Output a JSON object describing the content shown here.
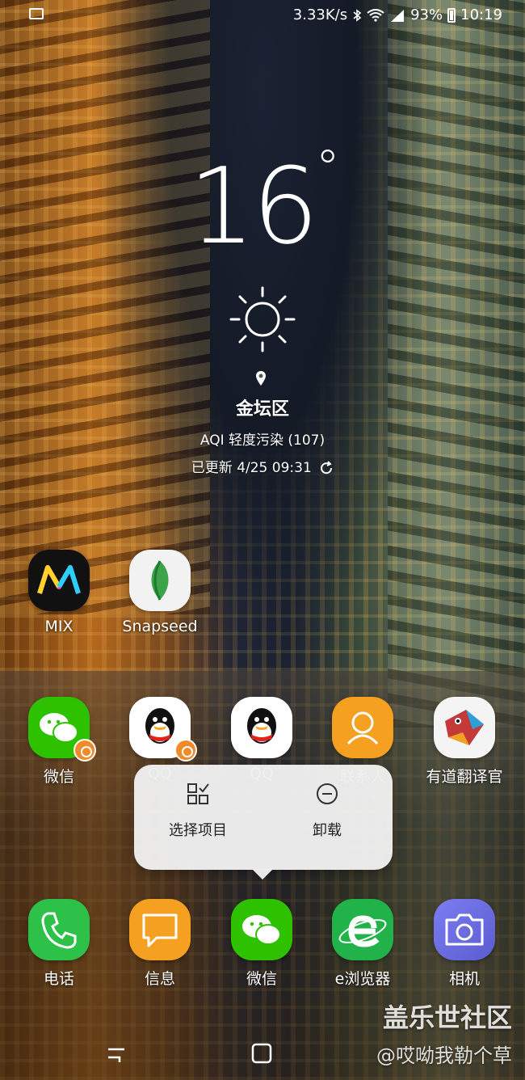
{
  "status_bar": {
    "net_speed": "3.33K/s",
    "battery": "93%",
    "time": "10:19",
    "icons": [
      "gallery-icon",
      "bluetooth-icon",
      "wifi-icon",
      "signal-icon",
      "battery-icon"
    ]
  },
  "weather": {
    "temperature": "16",
    "degree": "°",
    "icon": "sun-icon",
    "location": "金坛区",
    "aqi": "AQI 轻度污染 (107)",
    "updated": "已更新 4/25 09:31"
  },
  "apps_row1": [
    {
      "label": "MIX",
      "icon": "mix-app-icon"
    },
    {
      "label": "Snapseed",
      "icon": "snapseed-app-icon"
    }
  ],
  "apps_row2": [
    {
      "label": "微信",
      "icon": "wechat-app-icon",
      "clone": true
    },
    {
      "label": "QQ",
      "icon": "qq-app-icon",
      "clone": true
    },
    {
      "label": "QQ",
      "icon": "qq-app-icon",
      "clone": false
    },
    {
      "label": "联系人",
      "icon": "contacts-app-icon",
      "clone": false
    },
    {
      "label": "有道翻译官",
      "icon": "youdao-app-icon",
      "clone": false
    }
  ],
  "popup": {
    "select_label": "选择项目",
    "uninstall_label": "卸载"
  },
  "dock": [
    {
      "label": "电话",
      "icon": "phone-app-icon"
    },
    {
      "label": "信息",
      "icon": "messages-app-icon"
    },
    {
      "label": "微信",
      "icon": "wechat-app-icon"
    },
    {
      "label": "e浏览器",
      "icon": "browser-app-icon"
    },
    {
      "label": "相机",
      "icon": "camera-app-icon"
    }
  ],
  "watermark": {
    "line1": "盖乐世社区",
    "line2": "@哎呦我勒个草"
  },
  "colors": {
    "wechat_green": "#2dc100",
    "orange": "#f5a020",
    "youdao_red": "#c43a3a",
    "camera_purple": "#6d6ee0"
  }
}
